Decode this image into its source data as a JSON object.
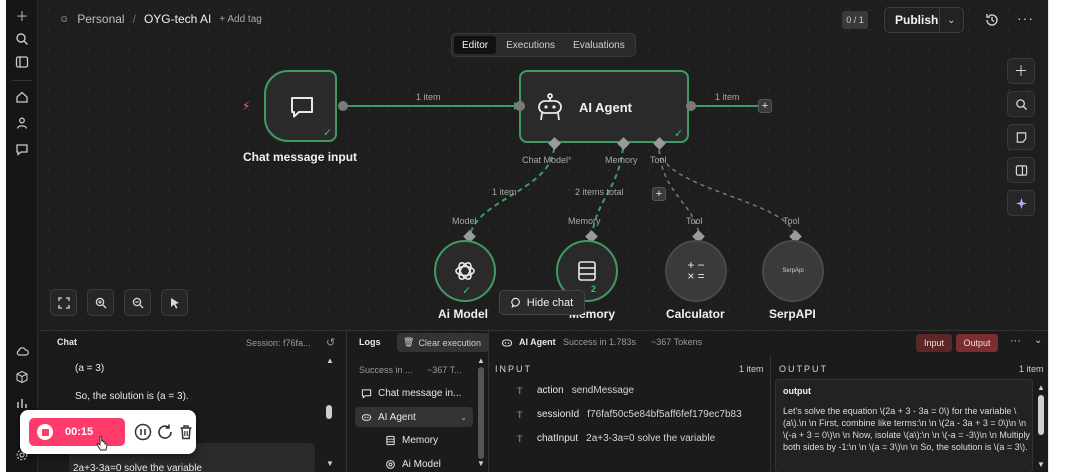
{
  "topbar": {
    "workspace": "Personal",
    "workflow_name": "OYG-tech AI",
    "add_tag": "+ Add tag",
    "version": "0 / 1",
    "publish": "Publish",
    "more": "···"
  },
  "tabs": [
    "Editor",
    "Executions",
    "Evaluations"
  ],
  "nodes": {
    "chat_trigger": "Chat message input",
    "agent": "AI Agent",
    "model": "Ai Model",
    "memory": "Memory",
    "calculator": "Calculator",
    "serpapi": "SerpAPI",
    "serpapi_logo_text": "SerpApi"
  },
  "connections": {
    "trigger_to_agent": "1 item",
    "agent_out": "1 item",
    "chat_model_port": "Chat Model",
    "chat_model_required": "*",
    "memory_port": "Memory",
    "tool_port": "Tool",
    "model_items": "1 item",
    "memory_items": "2 items total",
    "model_cap": "Model",
    "memory_cap": "Memory",
    "tool_cap_1": "Tool",
    "tool_cap_2": "Tool",
    "memory_badge": "2"
  },
  "hide_chat": "Hide chat",
  "chat_panel": {
    "title": "Chat",
    "session": "Session: f76fa...",
    "line1": "(a = 3)",
    "line2": "So, the solution is (a = 3).",
    "user_msg": "2a+3-3a=0 solve the variable"
  },
  "logs_panel": {
    "title": "Logs",
    "clear": "Clear execution",
    "status": "Success in ...",
    "tokens": "~367 T...",
    "items": [
      "Chat message in...",
      "AI Agent",
      "Memory",
      "Ai Model"
    ]
  },
  "run_info": {
    "name": "AI Agent",
    "status": "Success in 1.783s",
    "tokens": "~367 Tokens",
    "input_btn": "Input",
    "output_btn": "Output"
  },
  "input_panel": {
    "title": "INPUT",
    "count": "1 item",
    "fields": [
      {
        "key": "action",
        "value": "sendMessage"
      },
      {
        "key": "sessionId",
        "value": "f76faf50c5e84bf5aff6fef179ec7b83"
      },
      {
        "key": "chatInput",
        "value": "2a+3-3a=0 solve the variable"
      }
    ]
  },
  "output_panel": {
    "title": "OUTPUT",
    "count": "1 item",
    "field": "output",
    "text": "Let's solve the equation \\(2a + 3 - 3a = 0\\) for the variable \\(a\\).\\n \\n First, combine like terms:\\n \\n \\(2a - 3a + 3 = 0\\)\\n \\n \\(-a + 3 = 0\\)\\n \\n Now, isolate \\(a\\):\\n \\n \\(-a = -3\\)\\n \\n Multiply both sides by -1:\\n \\n \\(a = 3\\)\\n \\n So, the solution is \\(a = 3\\)."
  },
  "recorder": {
    "time": "00:15"
  }
}
